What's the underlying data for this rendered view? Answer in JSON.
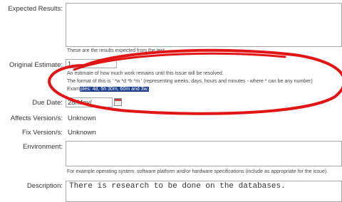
{
  "fields": {
    "expected_results": {
      "label": "Expected Results:",
      "hint": "These are the results expected from the test."
    },
    "original_estimate": {
      "label": "Original Estimate:",
      "value": "1",
      "hint_line1": "An estimate of how much work remains until this issue will be resolved.",
      "hint_line2": "The format of this is ' *w *d *h *m ' (representing weeks, days, hours and minutes - where * can be any number)",
      "hint_line3_prefix": "Exam",
      "hint_line3_selected": "ples: 4d, 5h 30m, 60m and 3w."
    },
    "due_date": {
      "label": "Due Date:",
      "value": "28/May/"
    },
    "affects_versions": {
      "label": "Affects Version/s:",
      "value": "Unknown"
    },
    "fix_versions": {
      "label": "Fix Version/s:",
      "value": "Unknown"
    },
    "environment": {
      "label": "Environment:",
      "hint": "For example operating system, software platform and/or hardware specifications (include as appropriate for the issue)."
    },
    "description": {
      "label": "Description:",
      "value": "There is research to be done on the databases."
    }
  },
  "annotation": {
    "color": "#e01515"
  }
}
